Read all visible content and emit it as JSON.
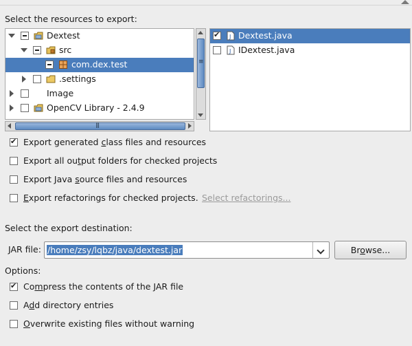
{
  "resources_label": "Select the resources to export:",
  "tree": [
    {
      "label": "Dextest",
      "state": "gray",
      "expander": "open",
      "icon": "project-icon"
    },
    {
      "label": "src",
      "state": "gray",
      "expander": "open",
      "icon": "source-folder-icon"
    },
    {
      "label": "com.dex.test",
      "state": "gray",
      "expander": "none",
      "icon": "package-icon",
      "selected": true
    },
    {
      "label": ".settings",
      "state": "unchecked",
      "expander": "closed",
      "icon": "folder-icon"
    },
    {
      "label": "Image",
      "state": "unchecked",
      "expander": "closed",
      "icon": "none"
    },
    {
      "label": "OpenCV Library - 2.4.9",
      "state": "unchecked",
      "expander": "closed",
      "icon": "project-icon"
    }
  ],
  "files": [
    {
      "label": "Dextest.java",
      "checked": true,
      "selected": true,
      "icon": "java-file-icon"
    },
    {
      "label": "IDextest.java",
      "checked": false,
      "selected": false,
      "icon": "java-file-icon"
    }
  ],
  "options_top": {
    "generated": {
      "pre": "Export generated ",
      "u": "c",
      "post": "lass files and resources",
      "checked": true
    },
    "output": {
      "pre": "Export all ou",
      "u": "t",
      "post": "put folders for checked projects",
      "checked": false
    },
    "source": {
      "pre": "Export Java ",
      "u": "s",
      "post": "ource files and resources",
      "checked": false
    },
    "refactor": {
      "pre": "",
      "u": "E",
      "post": "xport refactorings for checked projects.",
      "checked": false
    },
    "refactor_link": "Select refactorings..."
  },
  "destination_label": "Select the export destination:",
  "jar": {
    "label": "JAR file:",
    "value": "/home/zsy/lqbz/java/dextest.jar",
    "browse_pre": "Br",
    "browse_u": "o",
    "browse_post": "wse..."
  },
  "options_label": "Options:",
  "options": {
    "compress": {
      "pre": "Co",
      "u": "m",
      "post": "press the contents of the JAR file",
      "checked": true
    },
    "directory": {
      "pre": "A",
      "u": "d",
      "post": "d directory entries",
      "checked": false
    },
    "overwrite": {
      "pre": "",
      "u": "O",
      "post": "verwrite existing files without warning",
      "checked": false
    }
  },
  "colors": {
    "selection": "#4a7dbc",
    "link": "#9a9a9a",
    "background": "#ededed"
  }
}
